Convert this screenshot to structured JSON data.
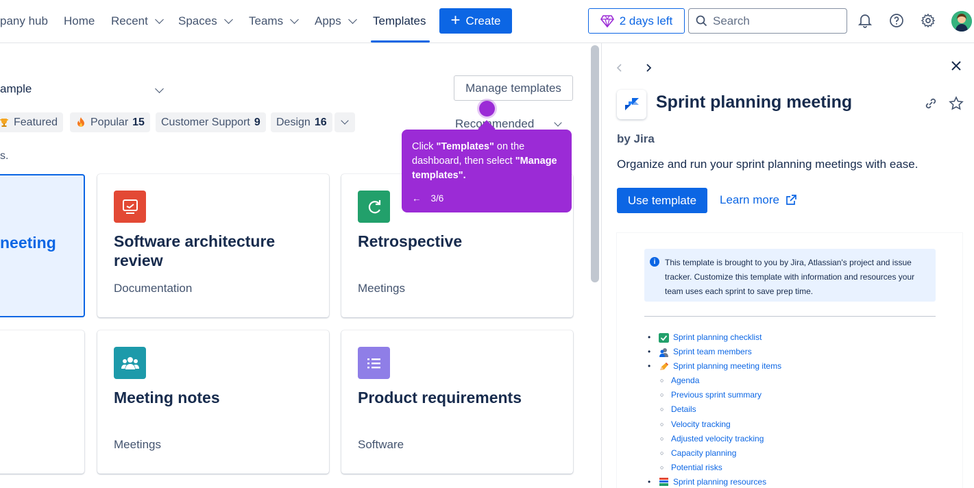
{
  "nav": {
    "brand": "pany hub",
    "items": [
      {
        "label": "Home"
      },
      {
        "label": "Recent"
      },
      {
        "label": "Spaces"
      },
      {
        "label": "Teams"
      },
      {
        "label": "Apps"
      },
      {
        "label": "Templates"
      }
    ],
    "create_label": "Create",
    "trial_label": "2 days left",
    "search_placeholder": "Search"
  },
  "left": {
    "category_value": "ample",
    "manage_label": "Manage templates",
    "chips": [
      {
        "label": "Featured",
        "count": ""
      },
      {
        "label": "Popular",
        "count": "15"
      },
      {
        "label": "Customer Support",
        "count": "9"
      },
      {
        "label": "Design",
        "count": "16"
      }
    ],
    "sort_value": "Recommended",
    "subtext": "s.",
    "cards": [
      {
        "title": "neeting",
        "sub": ""
      },
      {
        "title": "Software architecture review",
        "sub": "Documentation"
      },
      {
        "title": "Retrospective",
        "sub": "Meetings"
      },
      {
        "title": "",
        "sub": ""
      },
      {
        "title": "Meeting notes",
        "sub": "Meetings"
      },
      {
        "title": "Product requirements",
        "sub": "Software"
      }
    ]
  },
  "tooltip": {
    "pre": "Click ",
    "b1": "\"Templates\"",
    "mid": " on the dashboard, then select ",
    "b2": "\"Manage templates\".",
    "step": "3/6",
    "back_arrow": "←"
  },
  "panel": {
    "title": "Sprint planning meeting",
    "by": "by Jira",
    "desc": "Organize and run your sprint planning meetings with ease.",
    "use_label": "Use template",
    "learn_label": "Learn more",
    "info_text": "This template is brought to you by Jira, Atlassian's project and issue tracker. Customize this template with information and resources your team uses each sprint to save prep time.",
    "toc": [
      {
        "label": "Sprint planning checklist",
        "level": 1,
        "emoji": "check"
      },
      {
        "label": "Sprint team members",
        "level": 1,
        "emoji": "people"
      },
      {
        "label": "Sprint planning meeting items",
        "level": 1,
        "emoji": "pencil"
      },
      {
        "label": "Agenda",
        "level": 2
      },
      {
        "label": "Previous sprint summary",
        "level": 2
      },
      {
        "label": "Details",
        "level": 2
      },
      {
        "label": "Velocity tracking",
        "level": 2
      },
      {
        "label": "Adjusted velocity tracking",
        "level": 2
      },
      {
        "label": "Capacity planning",
        "level": 2
      },
      {
        "label": "Potential risks",
        "level": 2
      },
      {
        "label": "Sprint planning resources",
        "level": 1,
        "emoji": "books"
      }
    ]
  },
  "colors": {
    "brand_blue": "#0c66e4",
    "tooltip_purple": "#9b2bd6"
  }
}
